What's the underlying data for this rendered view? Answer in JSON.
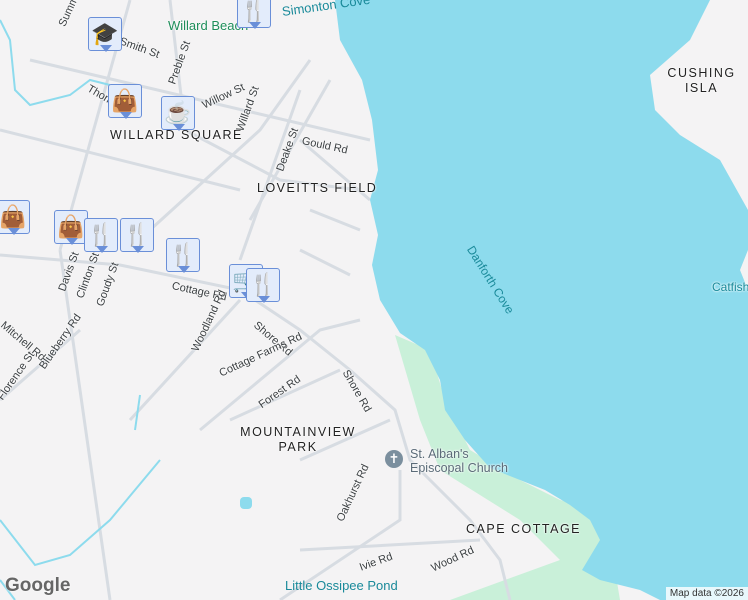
{
  "colors": {
    "water": "#8ddbed",
    "land": "#f4f3f4",
    "park": "#c9f0d9",
    "road": "#d7dce2",
    "pin_fill": "#e3ecfb",
    "pin_icon": "#0d4466"
  },
  "areas": [
    "WILLARD SQUARE",
    "LOVEITTS FIELD",
    "MOUNTAINVIEW PARK",
    "CAPE COTTAGE",
    "CUSHING ISLA"
  ],
  "water_labels": [
    "Simonton Cove",
    "Danforth Cove",
    "Little Ossipee Pond"
  ],
  "poi": {
    "beach": "Willard Beach",
    "church": "St. Alban's Episcopal Church",
    "catfish": "Catfish"
  },
  "streets": [
    "Summit St",
    "Smith St",
    "Preble St",
    "Willow St",
    "Thomas St",
    "Willard St",
    "Deake St",
    "Gould Rd",
    "Cottage Rd",
    "Davis St",
    "Clinton St",
    "Goudy St",
    "Mitchell Rd",
    "Woodland Rd",
    "Shore Rd",
    "Cottage Farms Rd",
    "Blueberry Rd",
    "Florence St",
    "Forest Rd",
    "Oakhurst Rd",
    "Ivie Rd",
    "Wood Rd",
    "Shore Rd"
  ],
  "pins": [
    {
      "icon": "restaurant-icon",
      "glyph": "🍴"
    },
    {
      "icon": "school-icon",
      "glyph": "🎓"
    },
    {
      "icon": "shopping-bag-icon",
      "glyph": "👜"
    },
    {
      "icon": "cafe-icon",
      "glyph": "☕"
    },
    {
      "icon": "shopping-bag-icon",
      "glyph": "👜"
    },
    {
      "icon": "shopping-bag-icon",
      "glyph": "👜"
    },
    {
      "icon": "restaurant-icon",
      "glyph": "🍴"
    },
    {
      "icon": "restaurant-icon",
      "glyph": "🍴"
    },
    {
      "icon": "restaurant-icon",
      "glyph": "🍴"
    },
    {
      "icon": "grocery-cart-icon",
      "glyph": "🛒"
    },
    {
      "icon": "restaurant-icon",
      "glyph": "🍴"
    }
  ],
  "google": "Google",
  "attribution": "Map data ©2026"
}
